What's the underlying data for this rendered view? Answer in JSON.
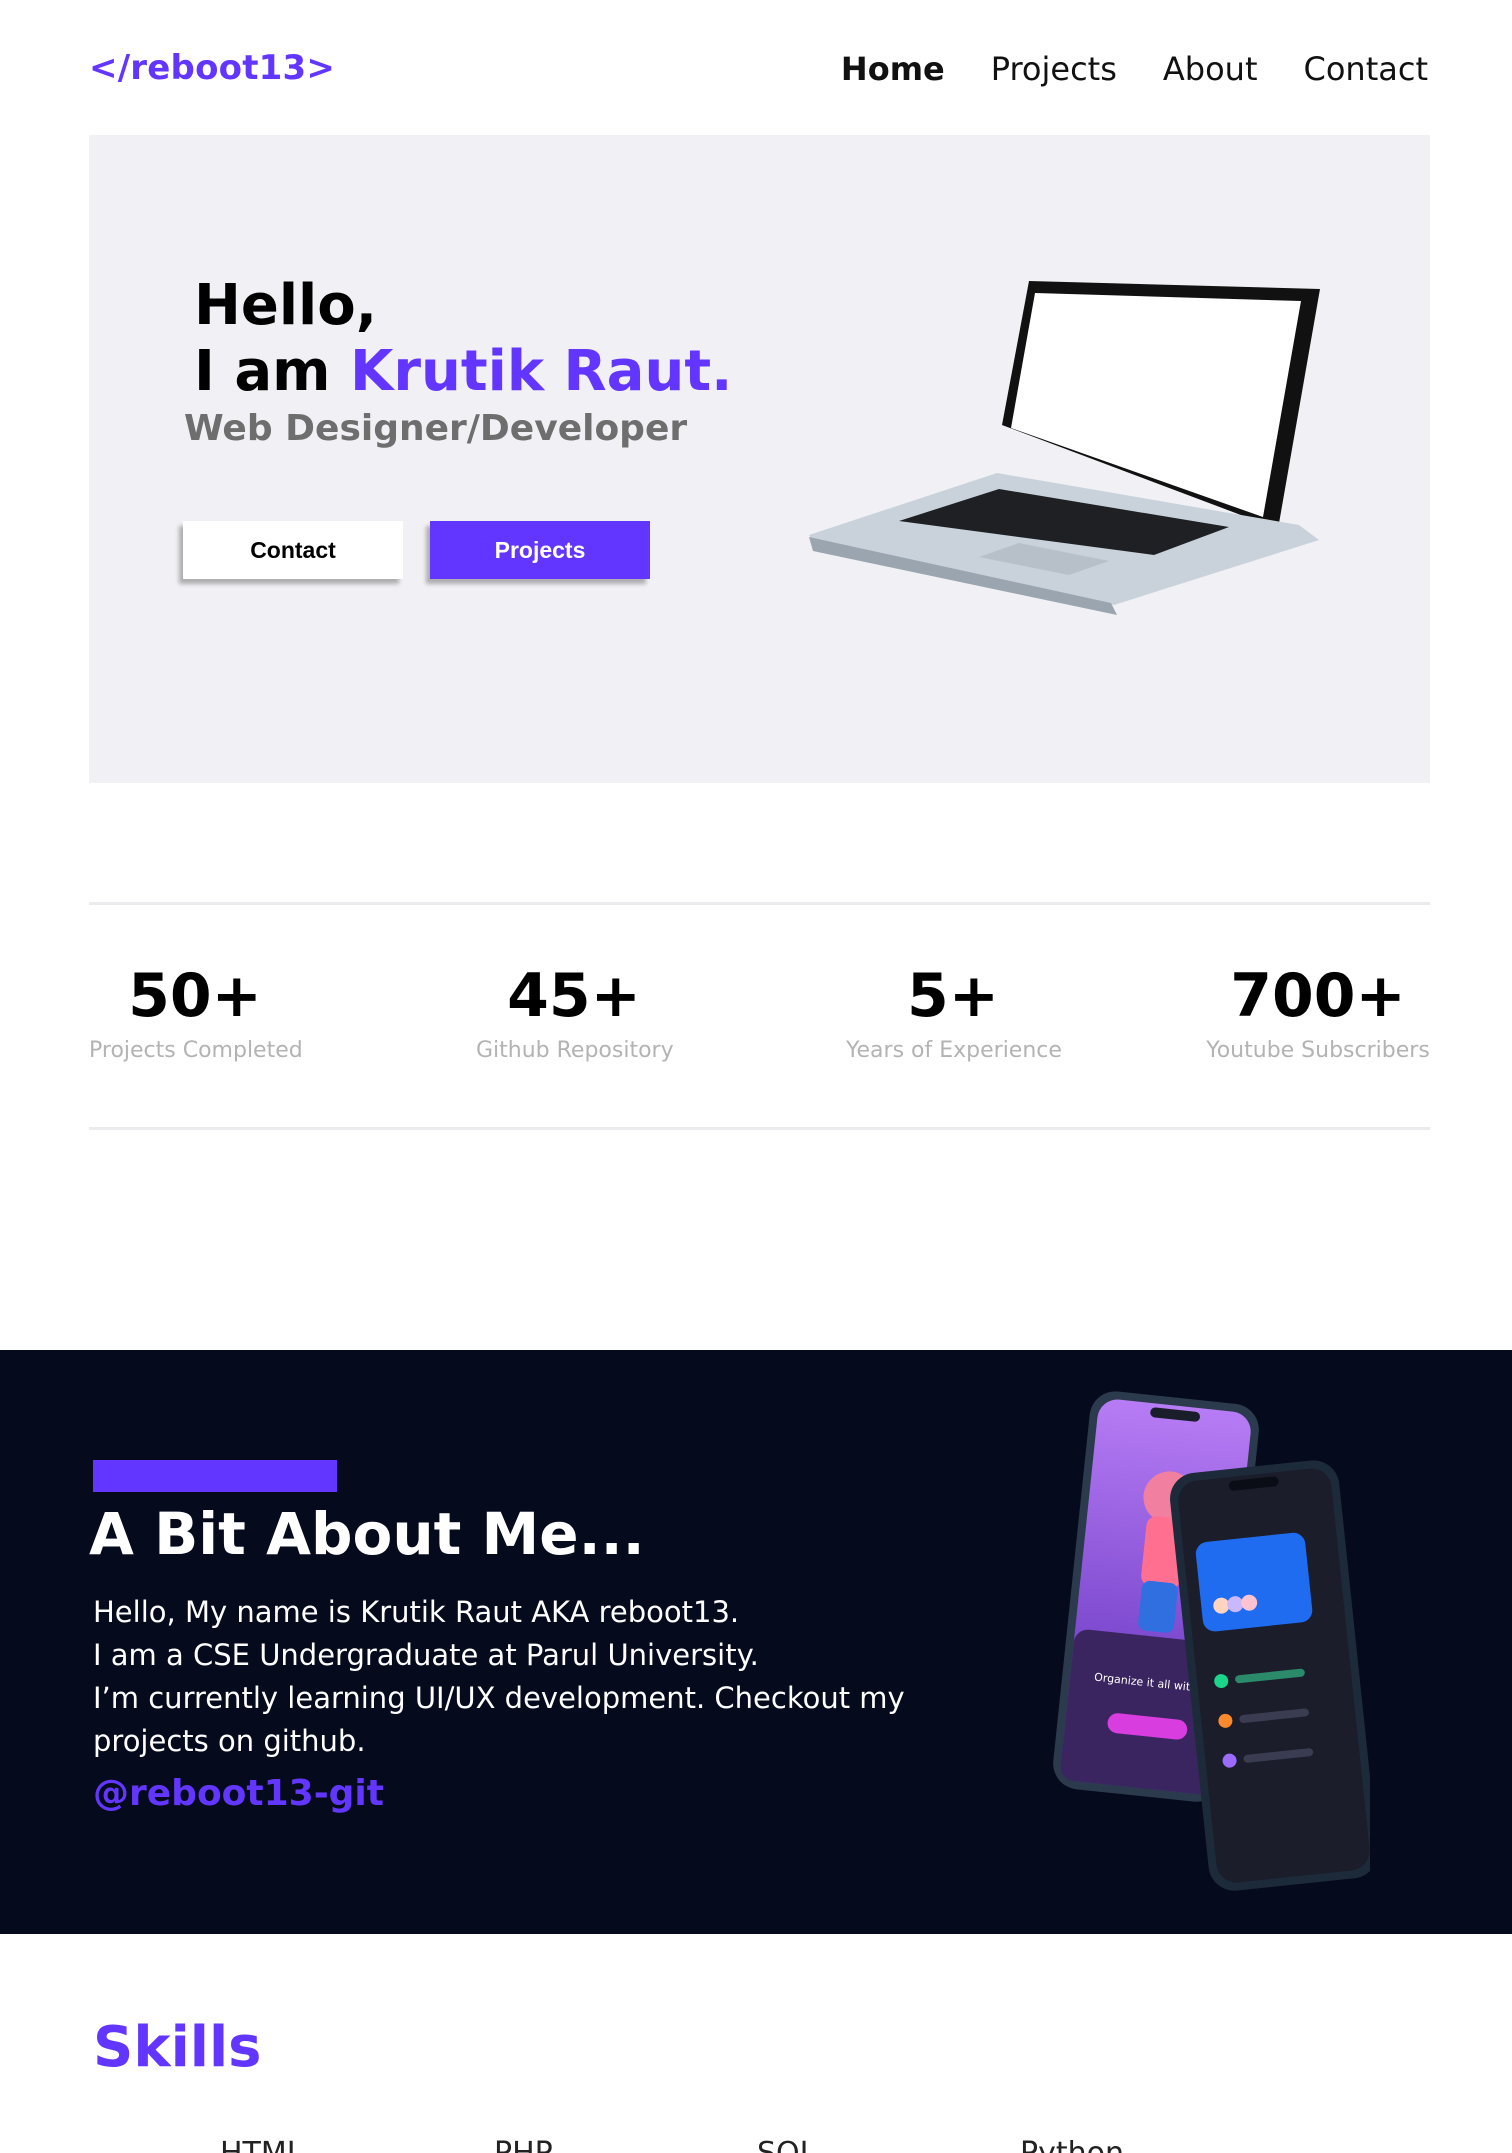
{
  "nav": {
    "logo": "</reboot13>",
    "links": [
      {
        "label": "Home",
        "active": true
      },
      {
        "label": "Projects",
        "active": false
      },
      {
        "label": "About",
        "active": false
      },
      {
        "label": "Contact",
        "active": false
      }
    ]
  },
  "hero": {
    "greeting": "Hello,",
    "intro_prefix": "I am ",
    "name": "Krutik Raut.",
    "role": "Web Designer/Developer",
    "contact_button": "Contact",
    "projects_button": "Projects"
  },
  "stats": [
    {
      "value": "50+",
      "label": "Projects Completed"
    },
    {
      "value": "45+",
      "label": "Github Repository"
    },
    {
      "value": "5+",
      "label": "Years of  Experience"
    },
    {
      "value": "700+",
      "label": "Youtube Subscribers"
    }
  ],
  "about": {
    "title": "A Bit About Me...",
    "lines": [
      "Hello, My name is Krutik Raut AKA reboot13.",
      "I am a CSE  Undergraduate at Parul University.",
      "I’m currently learning UI/UX development. Checkout my",
      "projects on github."
    ],
    "handle": "@reboot13-git",
    "phone_caption": "Organize it all with Estaro"
  },
  "skills": {
    "title": "Skills",
    "items": [
      "HTML",
      "PHP",
      "SQL",
      "Python"
    ]
  },
  "colors": {
    "accent": "#6236ff",
    "hero_bg": "#f1f0f4",
    "about_bg": "#050a1c",
    "muted_text": "#b3b3b3"
  }
}
